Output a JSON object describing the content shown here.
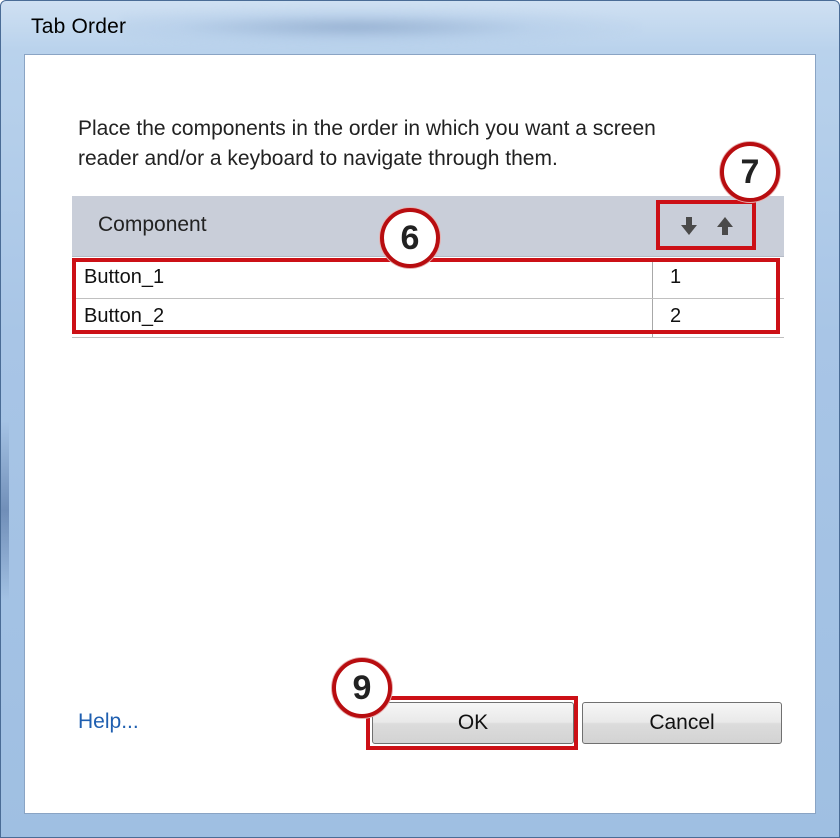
{
  "window": {
    "title": "Tab Order"
  },
  "instructions": {
    "line1": "Place the components in the order in which you want a  screen",
    "line2": "reader and/or a keyboard to navigate through them."
  },
  "table": {
    "column_header": "Component",
    "sort_down_icon": "arrow-down-icon",
    "sort_up_icon": "arrow-up-icon",
    "rows": [
      {
        "name": "Button_1",
        "order": "1"
      },
      {
        "name": "Button_2",
        "order": "2"
      }
    ]
  },
  "footer": {
    "help_label": "Help...",
    "ok_label": "OK",
    "cancel_label": "Cancel"
  },
  "annotations": {
    "rows_callout": "6",
    "sort_callout": "7",
    "ok_callout": "9"
  },
  "colors": {
    "annotation_red": "#cc1016",
    "link_blue": "#1f5fb0",
    "header_gray": "#c9ced9"
  }
}
